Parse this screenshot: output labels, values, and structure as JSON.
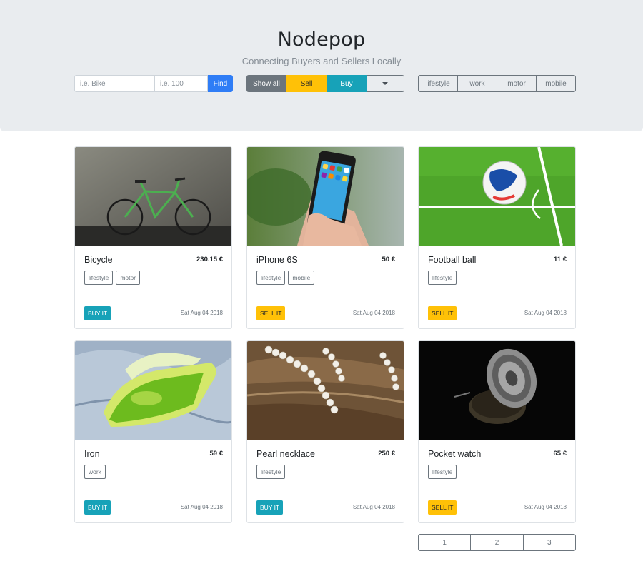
{
  "header": {
    "title": "Nodepop",
    "subtitle": "Connecting Buyers and Sellers Locally"
  },
  "search": {
    "name_placeholder": "i.e. Bike",
    "price_placeholder": "i.e. 100",
    "find_label": "Find"
  },
  "type_filter": {
    "show_all": "Show all",
    "sell": "Sell",
    "buy": "Buy"
  },
  "tag_filter": [
    "lifestyle",
    "work",
    "motor",
    "mobile"
  ],
  "adverts": [
    {
      "name": "Bicycle",
      "price": "230.15 €",
      "tags": [
        "lifestyle",
        "motor"
      ],
      "action": "BUY IT",
      "date": "Sat Aug 04 2018",
      "image": "bicycle-photo"
    },
    {
      "name": "iPhone 6S",
      "price": "50 €",
      "tags": [
        "lifestyle",
        "mobile"
      ],
      "action": "SELL IT",
      "date": "Sat Aug 04 2018",
      "image": "phone-photo"
    },
    {
      "name": "Football ball",
      "price": "11 €",
      "tags": [
        "lifestyle"
      ],
      "action": "SELL IT",
      "date": "Sat Aug 04 2018",
      "image": "football-photo"
    },
    {
      "name": "Iron",
      "price": "59 €",
      "tags": [
        "work"
      ],
      "action": "BUY IT",
      "date": "Sat Aug 04 2018",
      "image": "iron-photo"
    },
    {
      "name": "Pearl necklace",
      "price": "250 €",
      "tags": [
        "lifestyle"
      ],
      "action": "BUY IT",
      "date": "Sat Aug 04 2018",
      "image": "necklace-photo"
    },
    {
      "name": "Pocket watch",
      "price": "65 €",
      "tags": [
        "lifestyle"
      ],
      "action": "SELL IT",
      "date": "Sat Aug 04 2018",
      "image": "watch-photo"
    }
  ],
  "pagination": [
    "1",
    "2",
    "3"
  ],
  "colors": {
    "hero_bg": "#e9ecef",
    "find": "#2f7df6",
    "sell": "#ffc107",
    "buy": "#17a2b8",
    "show_all": "#6c757d"
  }
}
